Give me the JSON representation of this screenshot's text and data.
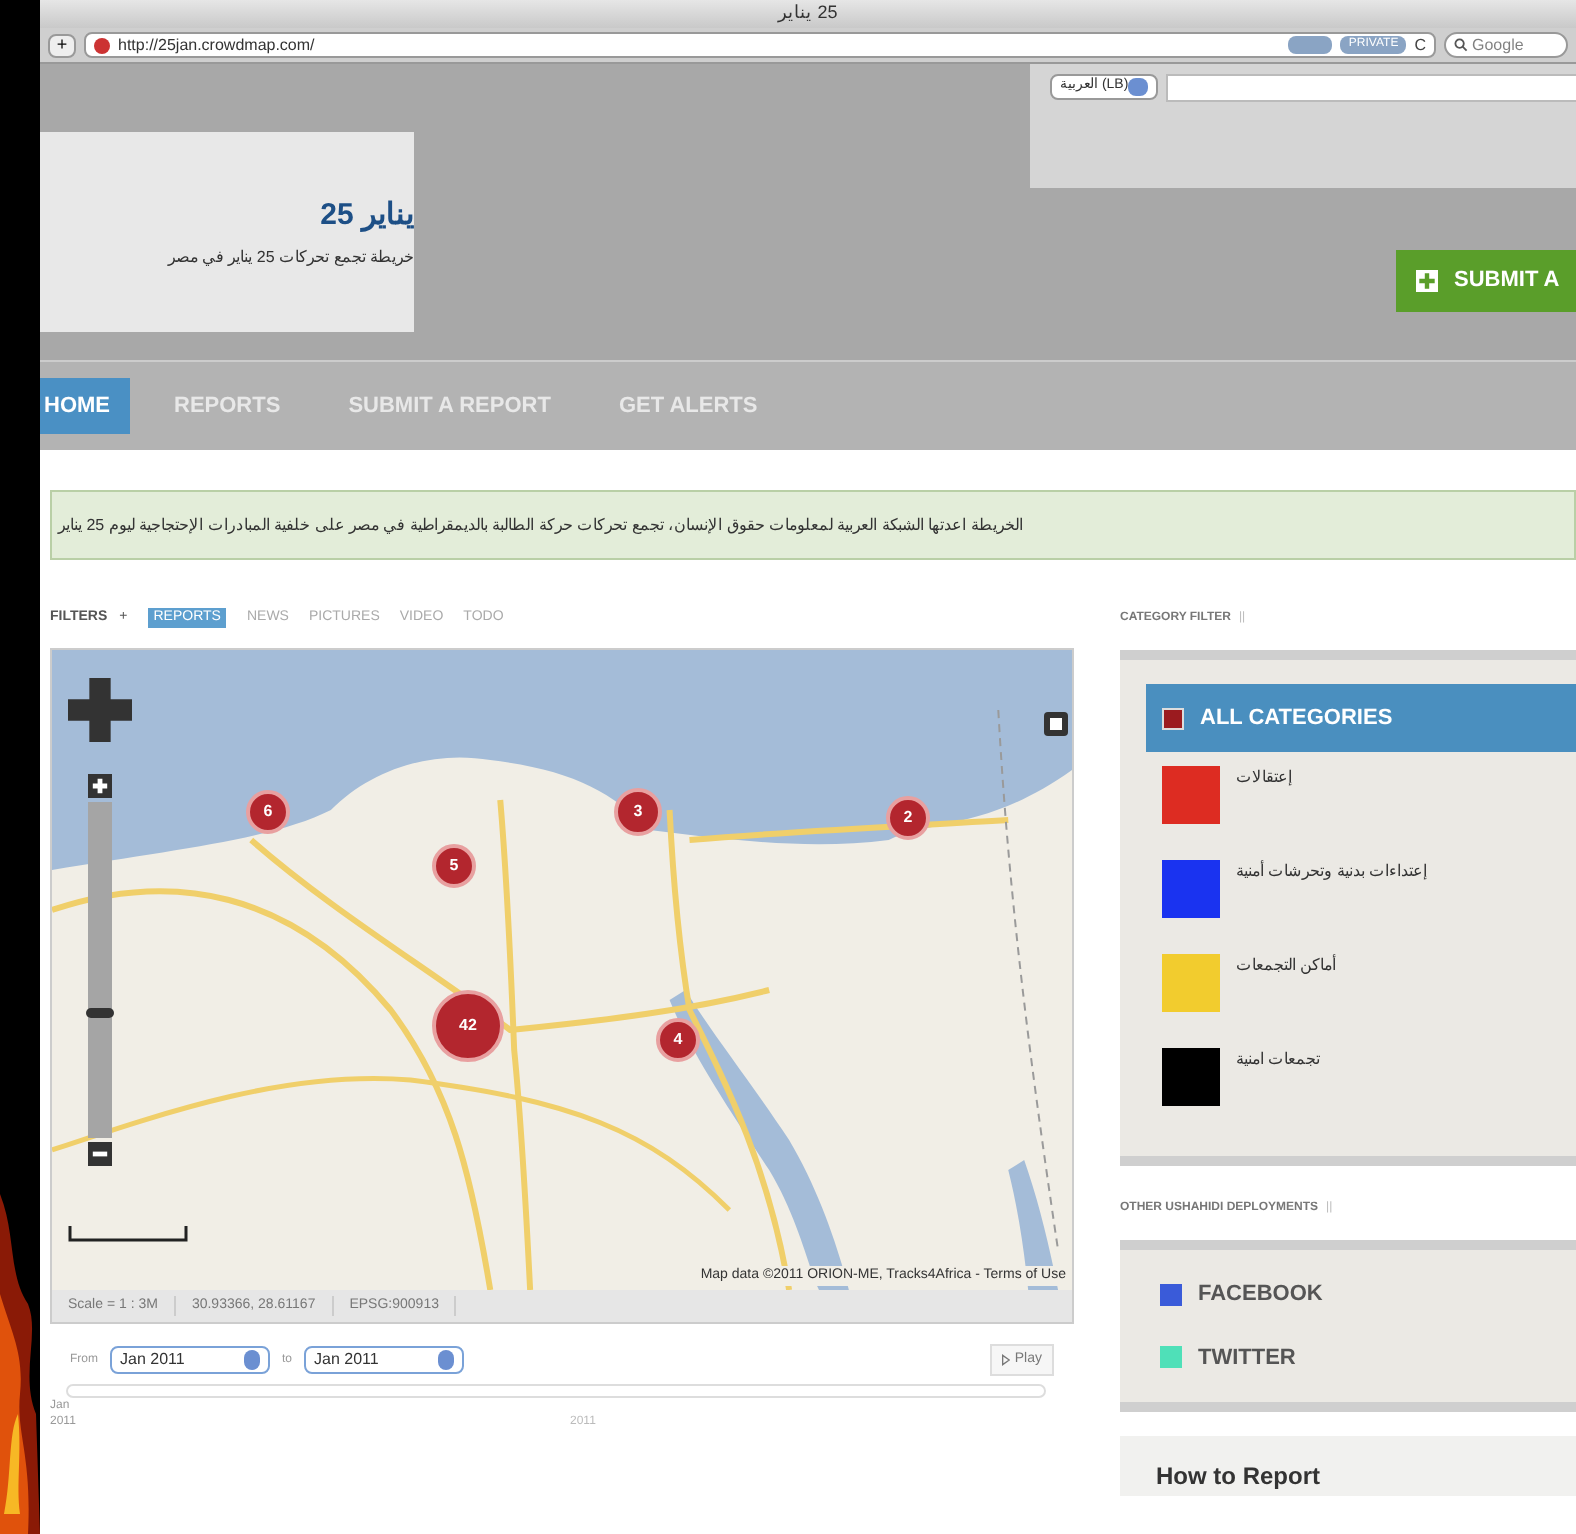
{
  "window": {
    "title": "25 يناير"
  },
  "toolbar": {
    "add_button": "+",
    "url": "http://25jan.crowdmap.com/",
    "badges": [
      {
        "label": "PRIVATE"
      }
    ],
    "reload": "C",
    "search": {
      "placeholder": "Google"
    }
  },
  "header": {
    "site_title": "يناير 25",
    "tagline": "خريطة تجمع تحركات 25 يناير في مصر",
    "language": "(LB) العربية",
    "submit_button": "SUBMIT A"
  },
  "nav": [
    {
      "label": "HOME",
      "selected": true
    },
    {
      "label": "REPORTS",
      "selected": false
    },
    {
      "label": "SUBMIT A REPORT",
      "selected": false
    },
    {
      "label": "GET ALERTS",
      "selected": false
    }
  ],
  "notice": "الخريطة اعدتها الشبكة العربية لمعلومات حقوق الإنسان، تجمع تحركات حركة الطالبة بالديمقراطية في مصر على خلفية المبادرات الإحتجاجية ليوم 25 يناير",
  "filters": {
    "label": "FILTERS",
    "toggle": "+",
    "items": [
      {
        "label": "REPORTS",
        "selected": true
      },
      {
        "label": "NEWS",
        "selected": false
      },
      {
        "label": "PICTURES",
        "selected": false
      },
      {
        "label": "VIDEO",
        "selected": false
      },
      {
        "label": "TODO",
        "selected": false
      }
    ]
  },
  "map": {
    "kind": "picture",
    "zoom": {
      "level": 0.37
    },
    "clusters": [
      {
        "count": "6"
      },
      {
        "count": "5"
      },
      {
        "count": "3"
      },
      {
        "count": "2"
      },
      {
        "count": "42"
      },
      {
        "count": "4"
      }
    ],
    "attribution": "Map data ©2011 ORION-ME, Tracks4Africa - Terms of Use",
    "status": [
      "Scale = 1 : 3M",
      "30.93366, 28.61167",
      "EPSG:900913"
    ]
  },
  "timeline": {
    "from_label": "From",
    "from": "Jan 2011",
    "to_label": "to",
    "to": "Jan 2011",
    "play": "Play",
    "start_label": "Jan 2011",
    "year_label": "2011"
  },
  "category_filter": {
    "title": "CATEGORY FILTER",
    "toggle": "||",
    "items": [
      {
        "label": "ALL CATEGORIES",
        "color": "#9b1b1f",
        "selected": true
      },
      {
        "label": "إعتقالات",
        "color": "#dd2c22",
        "selected": false
      },
      {
        "label": "إعتداءات بدنية وتحرشات أمنية",
        "color": "#1a33f0",
        "selected": false
      },
      {
        "label": "أماكن التجمعات",
        "color": "#f2cc2e",
        "selected": false
      },
      {
        "label": "تجمعات امنية",
        "color": "#000000",
        "selected": false
      }
    ]
  },
  "deployments": {
    "title": "OTHER USHAHIDI DEPLOYMENTS",
    "toggle": "||",
    "items": [
      {
        "label": "FACEBOOK",
        "color": "#3a5bd9"
      },
      {
        "label": "TWITTER",
        "color": "#4fe0b8"
      }
    ]
  },
  "how_to_report": {
    "title": "How to Report"
  }
}
